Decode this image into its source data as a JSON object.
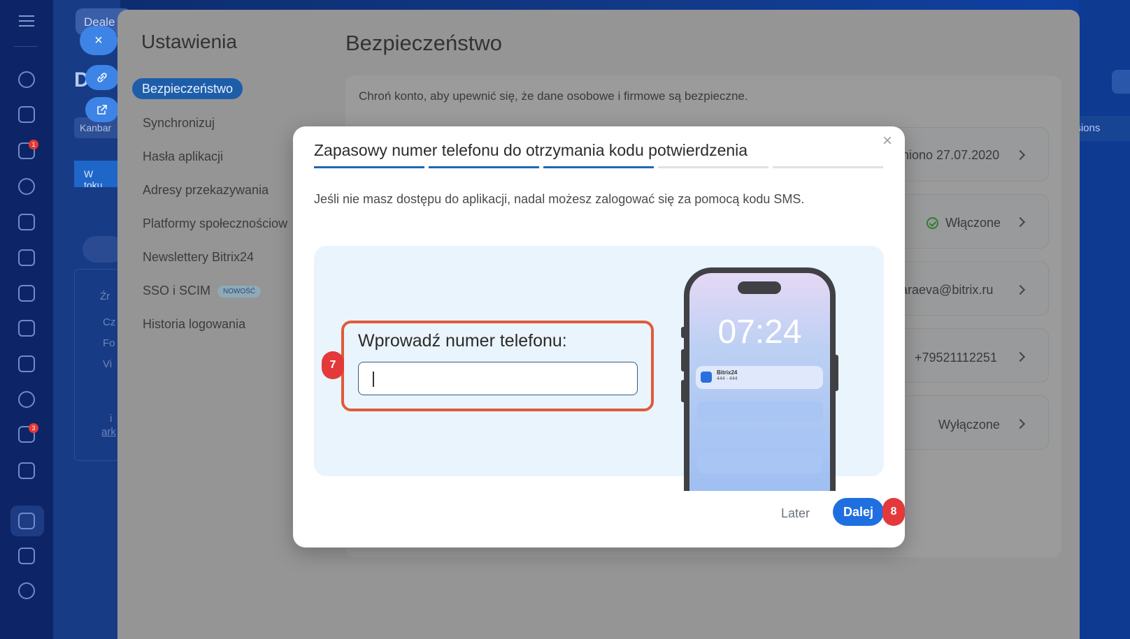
{
  "background": {
    "top_tag": "Deale",
    "big_letter": "D",
    "kanban_tab": "Kanbar",
    "status_tab": "W toku",
    "right_tab": "nsions",
    "left_list": {
      "label": "Źr",
      "items": [
        "Cz",
        "Fo",
        "Vi"
      ],
      "footer": [
        "i",
        "ark"
      ]
    }
  },
  "rail": {
    "badges": [
      "1",
      "3"
    ]
  },
  "fabs": {
    "close_icon": "×",
    "link_icon": "link-icon",
    "external_icon": "external-link-icon"
  },
  "settings": {
    "title": "Ustawienia",
    "nav": [
      {
        "label": "Bezpieczeństwo",
        "active": true
      },
      {
        "label": "Synchronizuj"
      },
      {
        "label": "Hasła aplikacji"
      },
      {
        "label": "Adresy przekazywania"
      },
      {
        "label": "Platformy społecznościow"
      },
      {
        "label": "Newslettery Bitrix24"
      },
      {
        "label": "SSO i SCIM",
        "tag": "NOWOŚĆ"
      },
      {
        "label": "Historia logowania"
      }
    ]
  },
  "security": {
    "title": "Bezpieczeństwo",
    "description": "Chroń konto, aby upewnić się, że dane osobowe i firmowe są bezpieczne.",
    "rows": [
      {
        "value": "niono 27.07.2020"
      },
      {
        "value": "Włączone",
        "status": "ok"
      },
      {
        "value": "baraeva@bitrix.ru"
      },
      {
        "value": "+79521112251"
      },
      {
        "value": "Wyłączone"
      }
    ]
  },
  "modal": {
    "title": "Zapasowy numer telefonu do otrzymania kodu potwierdzenia",
    "close": "×",
    "steps_total": 5,
    "steps_active": 3,
    "description": "Jeśli nie masz dostępu do aplikacji, nadal możesz zalogować się za pomocą kodu SMS.",
    "form_label": "Wprowadź numer telefonu:",
    "phone_input_value": "",
    "phone_mock": {
      "time": "07:24",
      "notification_title": "Bitrix24",
      "notification_code": "444 - 444"
    },
    "later_label": "Later",
    "next_label": "Dalej"
  },
  "annotations": {
    "badge_input": "7",
    "badge_next": "8",
    "color": "#e3393b"
  },
  "colors": {
    "accent": "#1f6fe0",
    "highlight": "#e05a3a",
    "ok": "#2e7d32"
  }
}
